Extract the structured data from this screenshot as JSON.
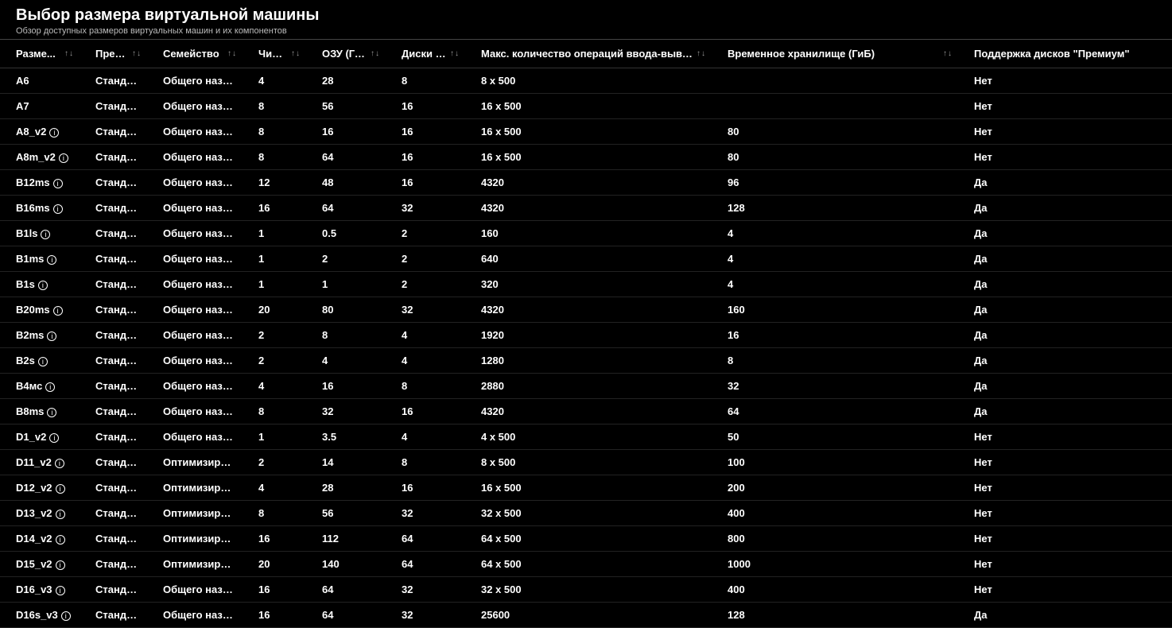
{
  "header": {
    "title": "Выбор размера виртуальной машины",
    "subtitle": "Обзор доступных размеров виртуальных машин и их компонентов"
  },
  "columns": [
    {
      "label": "Разме...",
      "sortable": true
    },
    {
      "label": "Предл...",
      "sortable": true
    },
    {
      "label": "Семейство",
      "sortable": true
    },
    {
      "label": "Числ...",
      "sortable": true
    },
    {
      "label": "ОЗУ (Ги...",
      "sortable": true
    },
    {
      "label": "Диски д...",
      "sortable": true
    },
    {
      "label": "Макс. количество операций ввода-вывод...",
      "sortable": true
    },
    {
      "label": "Временное хранилище (ГиБ)",
      "sortable": true
    },
    {
      "label": "Поддержка дисков \"Премиум\"",
      "sortable": false
    }
  ],
  "rows": [
    {
      "size": "A6",
      "info": false,
      "offer": "Стандар...",
      "family": "Общего назначе...",
      "vcpu": "4",
      "ram": "28",
      "disks": "8",
      "iops": "8 x 500",
      "temp": "",
      "premium": "Нет"
    },
    {
      "size": "A7",
      "info": false,
      "offer": "Стандар...",
      "family": "Общего назначе...",
      "vcpu": "8",
      "ram": "56",
      "disks": "16",
      "iops": "16 x 500",
      "temp": "",
      "premium": "Нет"
    },
    {
      "size": "A8_v2",
      "info": true,
      "offer": "Стандар...",
      "family": "Общего назначе...",
      "vcpu": "8",
      "ram": "16",
      "disks": "16",
      "iops": "16 x 500",
      "temp": "80",
      "premium": "Нет"
    },
    {
      "size": "A8m_v2",
      "info": true,
      "offer": "Стандар...",
      "family": "Общего назначе...",
      "vcpu": "8",
      "ram": "64",
      "disks": "16",
      "iops": "16 x 500",
      "temp": "80",
      "premium": "Нет"
    },
    {
      "size": "B12ms",
      "info": true,
      "offer": "Стандар...",
      "family": "Общего назначе...",
      "vcpu": "12",
      "ram": "48",
      "disks": "16",
      "iops": "4320",
      "temp": "96",
      "premium": "Да"
    },
    {
      "size": "B16ms",
      "info": true,
      "offer": "Стандар...",
      "family": "Общего назначе...",
      "vcpu": "16",
      "ram": "64",
      "disks": "32",
      "iops": "4320",
      "temp": "128",
      "premium": "Да"
    },
    {
      "size": "B1ls",
      "info": true,
      "offer": "Стандар...",
      "family": "Общего назначе...",
      "vcpu": "1",
      "ram": "0.5",
      "disks": "2",
      "iops": "160",
      "temp": "4",
      "premium": "Да"
    },
    {
      "size": "B1ms",
      "info": true,
      "offer": "Стандар...",
      "family": "Общего назначе...",
      "vcpu": "1",
      "ram": "2",
      "disks": "2",
      "iops": "640",
      "temp": "4",
      "premium": "Да"
    },
    {
      "size": "B1s",
      "info": true,
      "offer": "Стандар...",
      "family": "Общего назначе...",
      "vcpu": "1",
      "ram": "1",
      "disks": "2",
      "iops": "320",
      "temp": "4",
      "premium": "Да"
    },
    {
      "size": "B20ms",
      "info": true,
      "offer": "Стандар...",
      "family": "Общего назначе...",
      "vcpu": "20",
      "ram": "80",
      "disks": "32",
      "iops": "4320",
      "temp": "160",
      "premium": "Да"
    },
    {
      "size": "B2ms",
      "info": true,
      "offer": "Стандар...",
      "family": "Общего назначе...",
      "vcpu": "2",
      "ram": "8",
      "disks": "4",
      "iops": "1920",
      "temp": "16",
      "premium": "Да"
    },
    {
      "size": "B2s",
      "info": true,
      "offer": "Стандар...",
      "family": "Общего назначе...",
      "vcpu": "2",
      "ram": "4",
      "disks": "4",
      "iops": "1280",
      "temp": "8",
      "premium": "Да"
    },
    {
      "size": "B4мс",
      "info": true,
      "offer": "Стандар...",
      "family": "Общего назначе...",
      "vcpu": "4",
      "ram": "16",
      "disks": "8",
      "iops": "2880",
      "temp": "32",
      "premium": "Да"
    },
    {
      "size": "B8ms",
      "info": true,
      "offer": "Стандар...",
      "family": "Общего назначе...",
      "vcpu": "8",
      "ram": "32",
      "disks": "16",
      "iops": "4320",
      "temp": "64",
      "premium": "Да"
    },
    {
      "size": "D1_v2",
      "info": true,
      "offer": "Стандар...",
      "family": "Общего назначе...",
      "vcpu": "1",
      "ram": "3.5",
      "disks": "4",
      "iops": "4 x 500",
      "temp": "50",
      "premium": "Нет"
    },
    {
      "size": "D11_v2",
      "info": true,
      "offer": "Стандар...",
      "family": "Оптимизирован...",
      "vcpu": "2",
      "ram": "14",
      "disks": "8",
      "iops": "8 x 500",
      "temp": "100",
      "premium": "Нет"
    },
    {
      "size": "D12_v2",
      "info": true,
      "offer": "Стандар...",
      "family": "Оптимизирован...",
      "vcpu": "4",
      "ram": "28",
      "disks": "16",
      "iops": "16 x 500",
      "temp": "200",
      "premium": "Нет"
    },
    {
      "size": "D13_v2",
      "info": true,
      "offer": "Стандар...",
      "family": "Оптимизирован...",
      "vcpu": "8",
      "ram": "56",
      "disks": "32",
      "iops": "32 x 500",
      "temp": "400",
      "premium": "Нет"
    },
    {
      "size": "D14_v2",
      "info": true,
      "offer": "Стандар...",
      "family": "Оптимизирован...",
      "vcpu": "16",
      "ram": "112",
      "disks": "64",
      "iops": "64 x 500",
      "temp": "800",
      "premium": "Нет"
    },
    {
      "size": "D15_v2",
      "info": true,
      "offer": "Стандар...",
      "family": "Оптимизирован...",
      "vcpu": "20",
      "ram": "140",
      "disks": "64",
      "iops": "64 x 500",
      "temp": "1000",
      "premium": "Нет"
    },
    {
      "size": "D16_v3",
      "info": true,
      "offer": "Стандар...",
      "family": "Общего назначе...",
      "vcpu": "16",
      "ram": "64",
      "disks": "32",
      "iops": "32 x 500",
      "temp": "400",
      "premium": "Нет"
    },
    {
      "size": "D16s_v3",
      "info": true,
      "offer": "Стандар...",
      "family": "Общего назначе...",
      "vcpu": "16",
      "ram": "64",
      "disks": "32",
      "iops": "25600",
      "temp": "128",
      "premium": "Да"
    }
  ]
}
